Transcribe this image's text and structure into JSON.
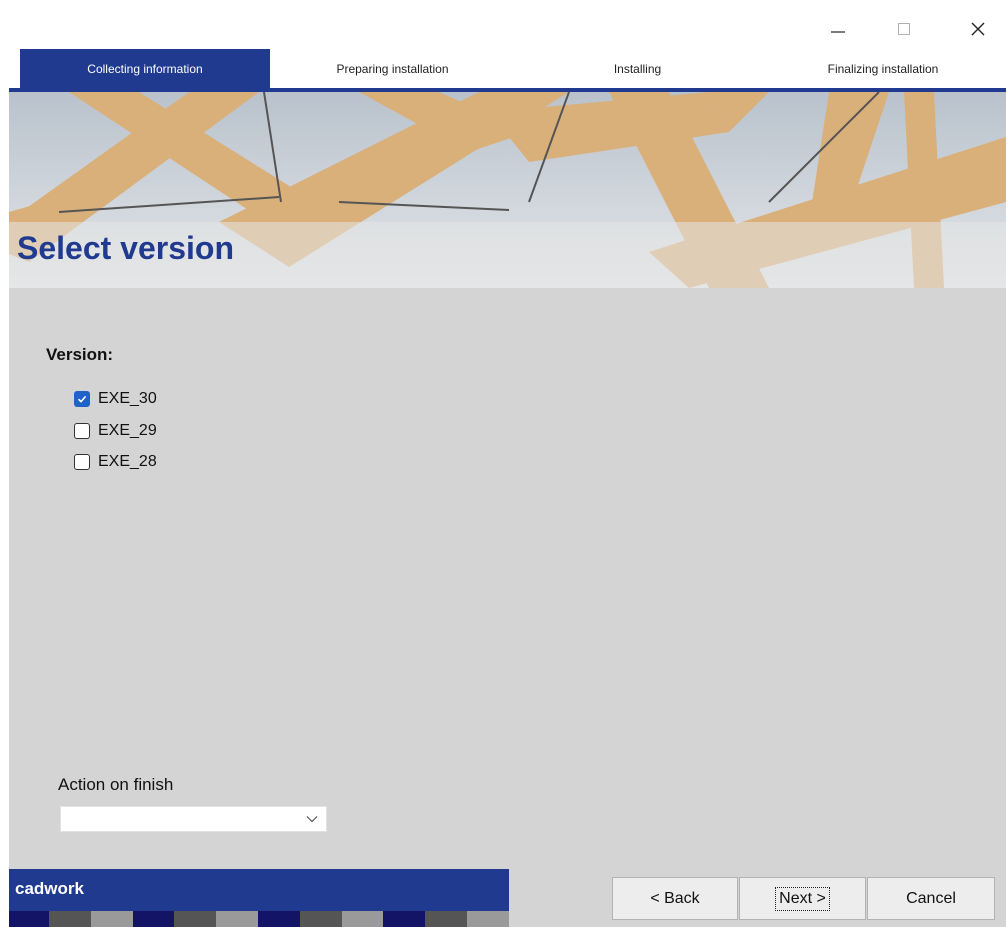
{
  "window": {
    "controls": {
      "minimize_icon": "minimize-icon",
      "maximize_icon": "maximize-icon",
      "close_icon": "close-icon"
    }
  },
  "steps": [
    {
      "label": "Collecting information",
      "active": true
    },
    {
      "label": "Preparing installation",
      "active": false
    },
    {
      "label": "Installing",
      "active": false
    },
    {
      "label": "Finalizing installation",
      "active": false
    }
  ],
  "banner": {
    "title": "Select version"
  },
  "version": {
    "label": "Version:",
    "options": [
      {
        "label": "EXE_30",
        "checked": true
      },
      {
        "label": "EXE_29",
        "checked": false
      },
      {
        "label": "EXE_28",
        "checked": false
      }
    ]
  },
  "action_on_finish": {
    "label": "Action on finish",
    "value": ""
  },
  "footer": {
    "brand": "cadwork",
    "back_label": "< Back",
    "next_label": "Next >",
    "cancel_label": "Cancel"
  },
  "colors": {
    "accent": "#1f3a8f",
    "checkbox": "#1f62c9",
    "background": "#d4d4d4"
  }
}
